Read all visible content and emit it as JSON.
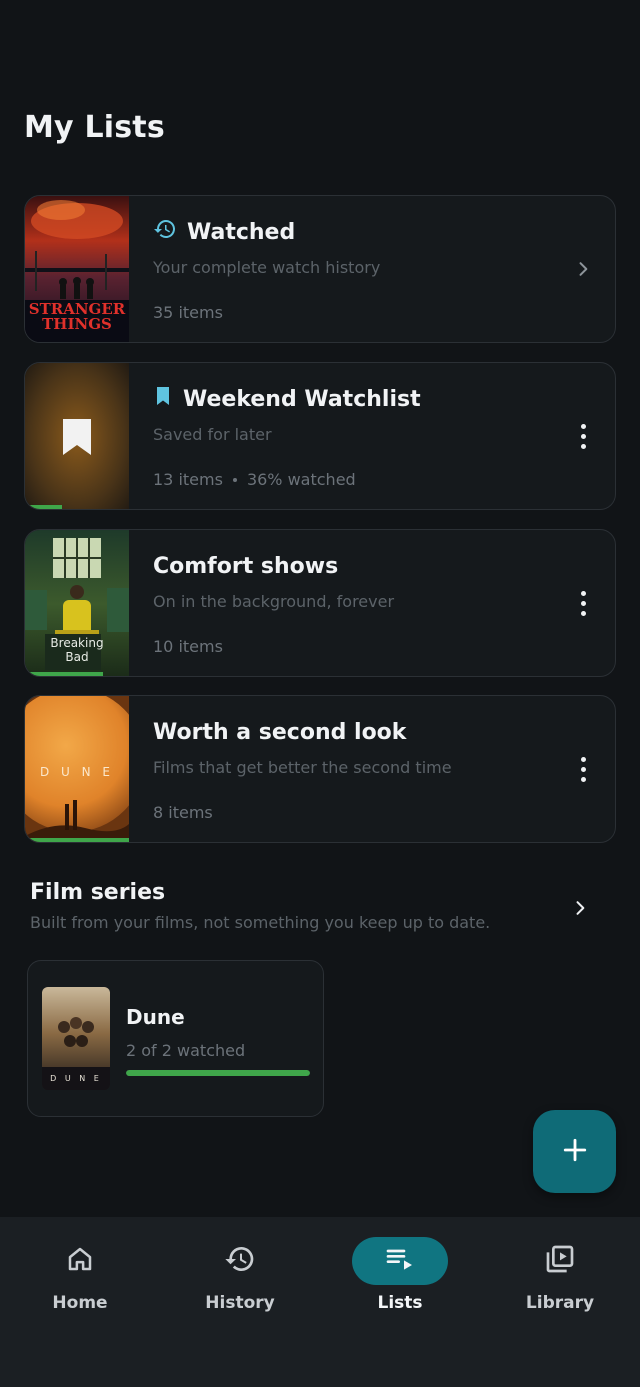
{
  "page": {
    "title": "My Lists"
  },
  "colors": {
    "background": "#111417",
    "accent": "#107581",
    "progress": "#3fa64a",
    "watched_icon": "#5fc4e0"
  },
  "lists": [
    {
      "title": "Watched",
      "subtitle": "Your complete watch history",
      "meta": "35 items",
      "meta_extra": "",
      "icon": "history-icon",
      "action": "chevron-right-icon",
      "poster": "Stranger Things",
      "poster_text_1": "STRANGER",
      "poster_text_2": "THINGS",
      "progress": 0
    },
    {
      "title": "Weekend Watchlist",
      "subtitle": "Saved for later",
      "meta": "13 items",
      "meta_extra": "36% watched",
      "icon": "bookmark-icon",
      "action": "more-vert-icon",
      "poster": "bookmark placeholder",
      "progress": 0.36
    },
    {
      "title": "Comfort shows",
      "subtitle": "On in the background, forever",
      "meta": "10 items",
      "meta_extra": "",
      "icon": "",
      "action": "more-vert-icon",
      "poster": "Breaking Bad",
      "poster_text_1": "Breaking",
      "poster_text_2": "Bad",
      "progress": 0.75
    },
    {
      "title": "Worth a second look",
      "subtitle": "Films that get better the second time",
      "meta": "8 items",
      "meta_extra": "",
      "icon": "",
      "action": "more-vert-icon",
      "poster": "Dune",
      "poster_text_1": "D U N E",
      "progress": 1.0
    }
  ],
  "film_series": {
    "title": "Film series",
    "subtitle": "Built from your films, not something you keep up to date.",
    "items": [
      {
        "title": "Dune",
        "meta": "2 of 2 watched",
        "progress": 1.0,
        "poster_text": "D U N E"
      }
    ]
  },
  "fab": {
    "icon": "plus-icon"
  },
  "nav": [
    {
      "label": "Home",
      "icon": "home-icon",
      "active": false
    },
    {
      "label": "History",
      "icon": "history-icon",
      "active": false
    },
    {
      "label": "Lists",
      "icon": "playlist-play-icon",
      "active": true
    },
    {
      "label": "Library",
      "icon": "video-library-icon",
      "active": false
    }
  ]
}
